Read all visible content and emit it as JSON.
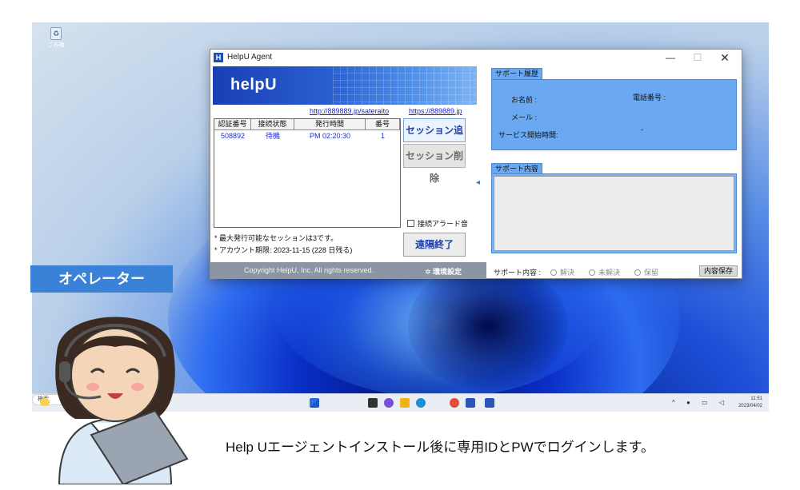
{
  "desktop": {
    "recycle_label": "ごみ箱"
  },
  "window": {
    "title": "HelpU Agent",
    "icon_letter": "H",
    "controls": {
      "minimize": "—",
      "maximize": "☐",
      "close": "✕"
    },
    "logo": "helpU",
    "links": [
      "http://889889.jp/sateraito",
      "https://889889.jp"
    ],
    "table": {
      "headers": [
        "認証番号",
        "接続状態",
        "発行時間",
        "番号"
      ],
      "rows": [
        [
          "508892",
          "待機",
          "PM 02:20:30",
          "1"
        ]
      ]
    },
    "buttons": {
      "add_session": "セッション追加",
      "delete_session": "セッション削除",
      "end_remote": "遠隔終了"
    },
    "alarm_label": "接続アラード音",
    "notes": [
      "* 最大発行可能なセッションは3です。",
      "* アカウント期限: 2023-11-15 (228 日残る)"
    ],
    "footer": {
      "copyright": "Copyright HelpU, Inc. All rights reserved.",
      "settings": "✲ 環境設定"
    },
    "history": {
      "tab": "サポート履歴",
      "name_label": "お名前 :",
      "phone_label": "電話番号 :",
      "mail_label": "メール :",
      "start_label": "サービス開始時間:",
      "start_value": "-"
    },
    "content": {
      "tab": "サポート内容"
    },
    "result": {
      "label": "サポート内容 :",
      "options": [
        "解決",
        "未解決",
        "保留"
      ],
      "save": "内容保存"
    }
  },
  "taskbar": {
    "search": "検索",
    "time": "11:51",
    "date": "2023/04/02"
  },
  "operator_label": "オペレーター",
  "caption": "Help Uエージェントインストール後に専用IDとPWでログインします。"
}
